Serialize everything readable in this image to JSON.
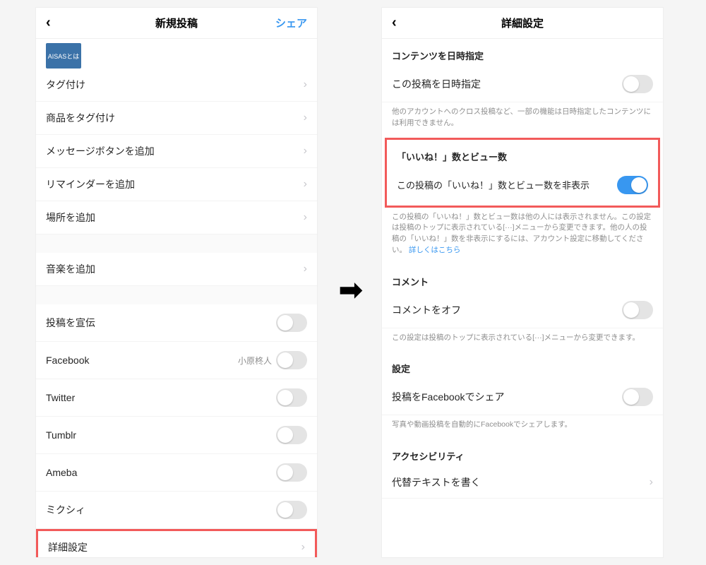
{
  "left": {
    "header": {
      "title": "新規投稿",
      "action": "シェア"
    },
    "thumb_text": "AISASとは",
    "rows": {
      "tag": "タグ付け",
      "product": "商品をタグ付け",
      "message": "メッセージボタンを追加",
      "reminder": "リマインダーを追加",
      "location": "場所を追加",
      "music": "音楽を追加",
      "promote": "投稿を宣伝",
      "facebook": "Facebook",
      "fb_name": "小原柊人",
      "twitter": "Twitter",
      "tumblr": "Tumblr",
      "ameba": "Ameba",
      "mixi": "ミクシィ",
      "advanced": "詳細設定"
    }
  },
  "right": {
    "header": {
      "title": "詳細設定"
    },
    "schedule": {
      "header": "コンテンツを日時指定",
      "row": "この投稿を日時指定",
      "desc": "他のアカウントへのクロス投稿など、一部の機能は日時指定したコンテンツには利用できません。"
    },
    "likes": {
      "header": "「いいね！」数とビュー数",
      "row": "この投稿の「いいね！」数とビュー数を非表示",
      "desc": "この投稿の「いいね！」数とビュー数は他の人には表示されません。この設定は投稿のトップに表示されている[···]メニューから変更できます。他の人の投稿の「いいね！」数を非表示にするには、アカウント設定に移動してください。",
      "link": "詳しくはこちら"
    },
    "comments": {
      "header": "コメント",
      "row": "コメントをオフ",
      "desc": "この設定は投稿のトップに表示されている[···]メニューから変更できます。"
    },
    "settings": {
      "header": "設定",
      "row": "投稿をFacebookでシェア",
      "desc": "写真や動画投稿を自動的にFacebookでシェアします。"
    },
    "accessibility": {
      "header": "アクセシビリティ",
      "row": "代替テキストを書く"
    }
  }
}
